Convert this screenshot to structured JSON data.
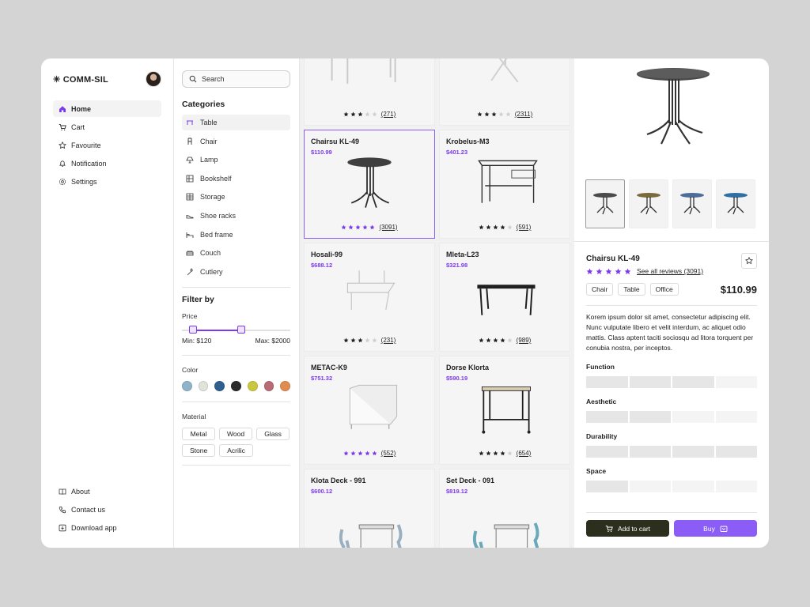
{
  "brand": {
    "name": "COMM-SIL"
  },
  "nav": {
    "items": [
      {
        "label": "Home",
        "icon": "home-icon",
        "active": true
      },
      {
        "label": "Cart",
        "icon": "cart-icon"
      },
      {
        "label": "Favourite",
        "icon": "star-icon"
      },
      {
        "label": "Notification",
        "icon": "bell-icon"
      },
      {
        "label": "Settings",
        "icon": "gear-icon"
      }
    ],
    "bottom": [
      {
        "label": "About",
        "icon": "book-icon"
      },
      {
        "label": "Contact us",
        "icon": "phone-icon"
      },
      {
        "label": "Download app",
        "icon": "download-icon"
      }
    ]
  },
  "search": {
    "placeholder": "Search"
  },
  "categories": {
    "title": "Categories",
    "items": [
      "Table",
      "Chair",
      "Lamp",
      "Bookshelf",
      "Storage",
      "Shoe racks",
      "Bed frame",
      "Couch",
      "Cutlery"
    ],
    "active": "Table"
  },
  "filter": {
    "title": "Filter by",
    "price_label": "Price",
    "min": "Min: $120",
    "max": "Max: $2000",
    "range_fraction": [
      0.1,
      0.55
    ],
    "color_label": "Color",
    "colors": [
      "#8fb3c9",
      "#dfe3d8",
      "#2f5f8f",
      "#2a2a2a",
      "#c9c640",
      "#b86b74",
      "#e08b4f"
    ],
    "material_label": "Material",
    "materials": [
      "Metal",
      "Wood",
      "Glass",
      "Stone",
      "Acrilic"
    ]
  },
  "products": [
    {
      "name": "",
      "price": "",
      "stars": 3,
      "reviews": "(271)",
      "img": "legs"
    },
    {
      "name": "",
      "price": "",
      "stars": 3,
      "reviews": "(2311)",
      "img": "folding"
    },
    {
      "name": "Chairsu KL-49",
      "price": "$110.99",
      "stars": 5,
      "reviews": "(3091)",
      "img": "round",
      "selected": true
    },
    {
      "name": "Krobelus-M3",
      "price": "$401.23",
      "stars": 4,
      "reviews": "(591)",
      "img": "console"
    },
    {
      "name": "Hosali-99",
      "price": "$688.12",
      "stars": 3,
      "reviews": "(231)",
      "img": "wall"
    },
    {
      "name": "Mleta-L23",
      "price": "$321.98",
      "stars": 4,
      "reviews": "(989)",
      "img": "desk"
    },
    {
      "name": "METAC-K9",
      "price": "$751.32",
      "stars": 5,
      "reviews": "(552)",
      "img": "white"
    },
    {
      "name": "Dorse Klorta",
      "price": "$590.19",
      "stars": 4,
      "reviews": "(654)",
      "img": "cart"
    },
    {
      "name": "Klota Deck - 991",
      "price": "$600.12",
      "stars": 0,
      "reviews": "",
      "img": "set-grey"
    },
    {
      "name": "Set Deck - 091",
      "price": "$819.12",
      "stars": 0,
      "reviews": "",
      "img": "set-blue"
    }
  ],
  "detail": {
    "title": "Chairsu KL-49",
    "stars": 5,
    "reviews_link": "See all reviews (3091)",
    "tags": [
      "Chair",
      "Table",
      "Office"
    ],
    "price": "$110.99",
    "description": "Korem ipsum dolor sit amet, consectetur adipiscing elit. Nunc vulputate libero et velit interdum, ac aliquet odio mattis. Class aptent taciti sociosqu ad litora torquent per conubia nostra, per inceptos.",
    "thumb_colors": [
      "#4a4a4a",
      "#7a6a3a",
      "#4c6c9a",
      "#2f6fa3"
    ],
    "metrics": [
      {
        "label": "Function",
        "level": 3
      },
      {
        "label": "Aesthetic",
        "level": 2
      },
      {
        "label": "Durability",
        "level": 4
      },
      {
        "label": "Space",
        "level": 1
      }
    ],
    "add_to_cart": "Add to cart",
    "buy": "Buy"
  }
}
